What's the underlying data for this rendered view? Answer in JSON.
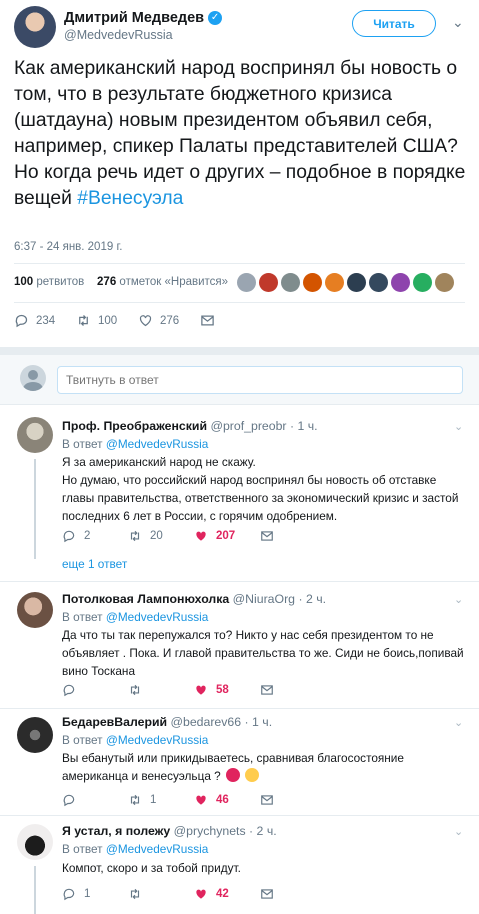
{
  "tweet": {
    "author_name": "Дмитрий Медведев",
    "author_handle": "@MedvedevRussia",
    "follow_label": "Читать",
    "text": "Как американский народ воспринял бы новость о том, что в результате бюджетного кризиса (шатдауна) новым президентом объявил себя, например, спикер Палаты представителей США? Но когда речь идет о других – подобное в порядке вещей ",
    "hashtag": "#Венесуэла",
    "timestamp": "6:37 - 24 янв. 2019 г.",
    "retweets_count": "100",
    "retweets_label": "ретвитов",
    "likes_count": "276",
    "likes_label": "отметок «Нравится»",
    "actions": {
      "replies": "234",
      "retweets": "100",
      "likes": "276"
    }
  },
  "reply_box": {
    "placeholder": "Твитнуть в ответ"
  },
  "replies": [
    {
      "name": "Проф. Преображенский",
      "handle": "@prof_preobr",
      "time": "· 1 ч.",
      "in_reply_prefix": "В ответ",
      "in_reply_to": "@MedvedevRussia",
      "text": "Я за американский народ не скажу.\nНо думаю, что российский народ воспринял бы новость об отставке главы правительства, ответственного за экономический кризис и застой последних 6 лет в России, с горячим одобрением.",
      "replies": "2",
      "retweets": "20",
      "likes": "207",
      "more": "еще 1 ответ"
    },
    {
      "name": "Потолковая Лампонюхолка",
      "handle": "@NiuraOrg",
      "time": "· 2 ч.",
      "in_reply_prefix": "В ответ",
      "in_reply_to": "@MedvedevRussia",
      "text": "Да что ты так перепужался то? Никто у нас себя президентом то не объявляет . Пока. И главой правительства то же. Сиди не боись,попивай вино Тоскана",
      "replies": "",
      "retweets": "",
      "likes": "58"
    },
    {
      "name": "БедаревВалерий",
      "handle": "@bedarev66",
      "time": "· 1 ч.",
      "in_reply_prefix": "В ответ",
      "in_reply_to": "@MedvedevRussia",
      "text": "Вы ебанутый или прикидываетесь, сравнивая благосостояние американца и венесуэльца ?",
      "replies": "",
      "retweets": "1",
      "likes": "46"
    },
    {
      "name": "Я устал, я полежу",
      "handle": "@prychynets",
      "time": "· 2 ч.",
      "in_reply_prefix": "В ответ",
      "in_reply_to": "@MedvedevRussia",
      "text": "Компот, скоро и за тобой придут.",
      "replies": "1",
      "retweets": "",
      "likes": "42"
    }
  ],
  "colors": {
    "accent": "#1da1f2",
    "like": "#e0245e",
    "muted": "#657786"
  },
  "icons": [
    "verified-badge-icon",
    "chevron-down-icon",
    "reply-icon",
    "retweet-icon",
    "heart-icon",
    "mail-icon"
  ]
}
